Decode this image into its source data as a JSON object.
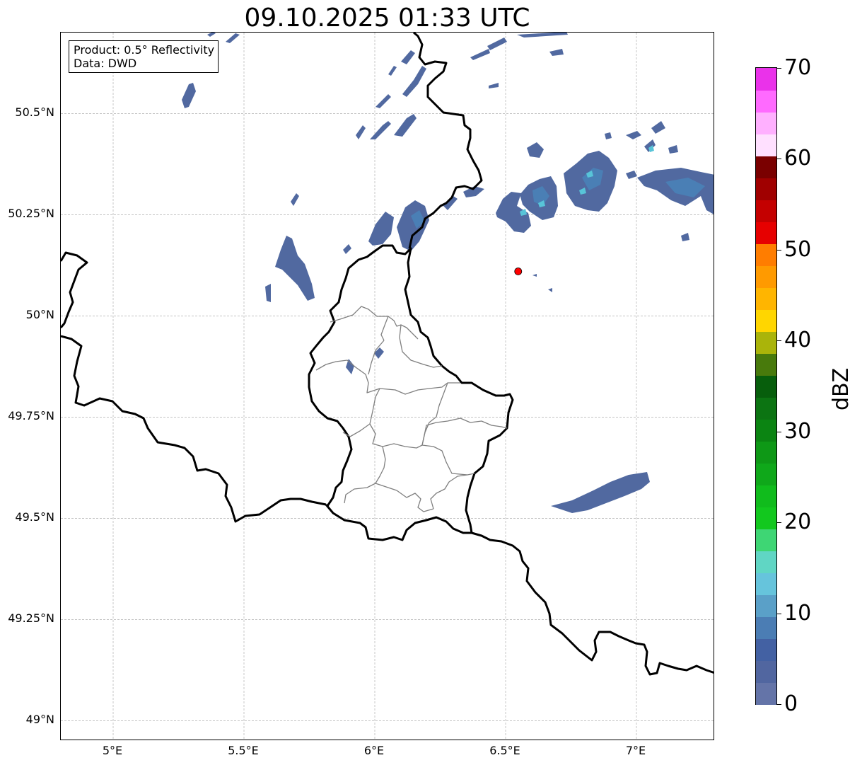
{
  "title": "09.10.2025 01:33 UTC",
  "info_box": {
    "line1": "Product: 0.5° Reflectivity",
    "line2": "Data: DWD"
  },
  "map_extent": {
    "lon_min": 4.8,
    "lon_max": 7.3,
    "lat_min": 48.95,
    "lat_max": 50.7
  },
  "lat_ticks": [
    {
      "value": 50.5,
      "label": "50.5°N"
    },
    {
      "value": 50.25,
      "label": "50.25°N"
    },
    {
      "value": 50.0,
      "label": "50°N"
    },
    {
      "value": 49.75,
      "label": "49.75°N"
    },
    {
      "value": 49.5,
      "label": "49.5°N"
    },
    {
      "value": 49.25,
      "label": "49.25°N"
    },
    {
      "value": 49.0,
      "label": "49°N"
    }
  ],
  "lon_ticks": [
    {
      "value": 5.0,
      "label": "5°E"
    },
    {
      "value": 5.5,
      "label": "5.5°E"
    },
    {
      "value": 6.0,
      "label": "6°E"
    },
    {
      "value": 6.5,
      "label": "6.5°E"
    },
    {
      "value": 7.0,
      "label": "7°E"
    }
  ],
  "radar_site": {
    "lon": 6.548,
    "lat": 50.11,
    "color": "#ff0000"
  },
  "colorbar": {
    "title": "dBZ",
    "min": 0,
    "max": 70,
    "tick_labels": [
      "0",
      "10",
      "20",
      "30",
      "40",
      "50",
      "60",
      "70"
    ],
    "colors": [
      "#6474a8",
      "#5166a0",
      "#4361a3",
      "#4b7db4",
      "#5aa0c8",
      "#66c4dc",
      "#60d6c4",
      "#3ed674",
      "#12c81e",
      "#10bc1c",
      "#0fa81a",
      "#0e9816",
      "#0b8412",
      "#0c7412",
      "#075e0c",
      "#487a0c",
      "#aab40a",
      "#ffd600",
      "#ffb500",
      "#ff9a00",
      "#ff7d00",
      "#e60000",
      "#c40000",
      "#a00000",
      "#7a0000",
      "#ffe0ff",
      "#ffb0ff",
      "#ff6aff",
      "#ea32ea"
    ]
  },
  "echo_colors": {
    "light": "#5169a0",
    "medium": "#4a7fb5",
    "bright": "#58c4d8"
  },
  "colors": {
    "border": "#000000",
    "admin_border": "#7f7f7f",
    "grid": "#b0b0b0"
  }
}
